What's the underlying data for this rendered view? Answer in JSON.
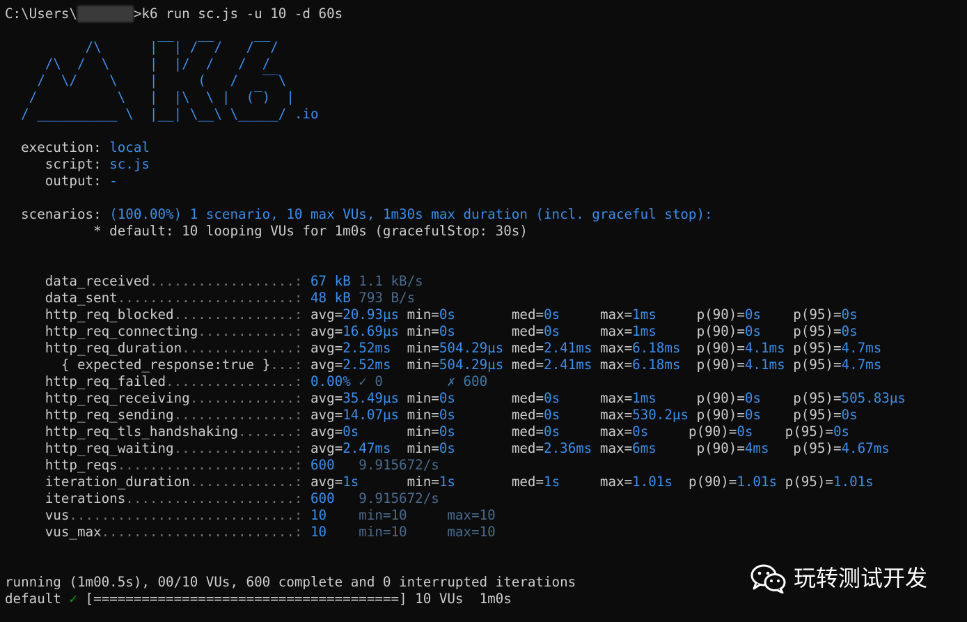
{
  "prompt": {
    "prefix": "C:\\Users\\",
    "mask": "xxxxx_x",
    "suffix": ">k6 run sc.js -u 10 -d 60s"
  },
  "logo": [
    "          /\\      |‾‾| /‾‾/   /‾‾/",
    "     /\\  /  \\     |  |/  /   /  /",
    "    /  \\/    \\    |     (   /   ‾‾\\",
    "   /          \\   |  |\\  \\ |  (‾)  |",
    "  / __________ \\  |__| \\__\\ \\_____/ .io"
  ],
  "execution": {
    "label": "  execution: ",
    "value": "local"
  },
  "script": {
    "label": "     script: ",
    "value": "sc.js"
  },
  "output": {
    "label": "     output: ",
    "value": "-"
  },
  "scenarios": {
    "label": "  scenarios: ",
    "value": "(100.00%) 1 scenario, 10 max VUs, 1m30s max duration (incl. graceful stop):",
    "detail": "           * default: 10 looping VUs for 1m0s (gracefulStop: 30s)"
  },
  "metrics": {
    "data_received": {
      "name": "     data_received",
      "dots": "..................: ",
      "v1": "67 kB",
      "v2": " 1.1 kB/s"
    },
    "data_sent": {
      "name": "     data_sent",
      "dots": "......................: ",
      "v1": "48 kB",
      "v2": " 793 B/s"
    },
    "http_req_blocked": {
      "name": "     http_req_blocked",
      "dots": "...............: ",
      "c": [
        [
          "avg=",
          "20.93µs",
          " "
        ],
        [
          "min=",
          "0s",
          "       "
        ],
        [
          "med=",
          "0s",
          "     "
        ],
        [
          "max=",
          "1ms",
          "     "
        ],
        [
          "p(90)=",
          "0s",
          "    "
        ],
        [
          "p(95)=",
          "0s",
          ""
        ]
      ]
    },
    "http_req_connecting": {
      "name": "     http_req_connecting",
      "dots": "............: ",
      "c": [
        [
          "avg=",
          "16.69µs",
          " "
        ],
        [
          "min=",
          "0s",
          "       "
        ],
        [
          "med=",
          "0s",
          "     "
        ],
        [
          "max=",
          "1ms",
          "     "
        ],
        [
          "p(90)=",
          "0s",
          "    "
        ],
        [
          "p(95)=",
          "0s",
          ""
        ]
      ]
    },
    "http_req_duration": {
      "name": "     http_req_duration",
      "dots": "..............: ",
      "c": [
        [
          "avg=",
          "2.52ms",
          "  "
        ],
        [
          "min=",
          "504.29µs",
          " "
        ],
        [
          "med=",
          "2.41ms",
          " "
        ],
        [
          "max=",
          "6.18ms",
          "  "
        ],
        [
          "p(90)=",
          "4.1ms",
          " "
        ],
        [
          "p(95)=",
          "4.7ms",
          ""
        ]
      ]
    },
    "expected_response": {
      "name": "       { expected_response:true }",
      "dots": "...: ",
      "c": [
        [
          "avg=",
          "2.52ms",
          "  "
        ],
        [
          "min=",
          "504.29µs",
          " "
        ],
        [
          "med=",
          "2.41ms",
          " "
        ],
        [
          "max=",
          "6.18ms",
          "  "
        ],
        [
          "p(90)=",
          "4.1ms",
          " "
        ],
        [
          "p(95)=",
          "4.7ms",
          ""
        ]
      ]
    },
    "http_req_failed": {
      "name": "     http_req_failed",
      "dots": "................: ",
      "v1": "0.00%",
      "check": " ✓ 0",
      "cross": "        ✗ 600"
    },
    "http_req_receiving": {
      "name": "     http_req_receiving",
      "dots": ".............: ",
      "c": [
        [
          "avg=",
          "35.49µs",
          " "
        ],
        [
          "min=",
          "0s",
          "       "
        ],
        [
          "med=",
          "0s",
          "     "
        ],
        [
          "max=",
          "1ms",
          "     "
        ],
        [
          "p(90)=",
          "0s",
          "    "
        ],
        [
          "p(95)=",
          "505.83µs",
          ""
        ]
      ]
    },
    "http_req_sending": {
      "name": "     http_req_sending",
      "dots": "...............: ",
      "c": [
        [
          "avg=",
          "14.07µs",
          " "
        ],
        [
          "min=",
          "0s",
          "       "
        ],
        [
          "med=",
          "0s",
          "     "
        ],
        [
          "max=",
          "530.2µs",
          " "
        ],
        [
          "p(90)=",
          "0s",
          "    "
        ],
        [
          "p(95)=",
          "0s",
          ""
        ]
      ]
    },
    "http_req_tls_handshaking": {
      "name": "     http_req_tls_handshaking",
      "dots": ".......: ",
      "c": [
        [
          "avg=",
          "0s",
          "      "
        ],
        [
          "min=",
          "0s",
          "       "
        ],
        [
          "med=",
          "0s",
          "     "
        ],
        [
          "max=",
          "0s",
          "     "
        ],
        [
          "p(90)=",
          "0s",
          "    "
        ],
        [
          "p(95)=",
          "0s",
          ""
        ]
      ]
    },
    "http_req_waiting": {
      "name": "     http_req_waiting",
      "dots": "...............: ",
      "c": [
        [
          "avg=",
          "2.47ms",
          "  "
        ],
        [
          "min=",
          "0s",
          "       "
        ],
        [
          "med=",
          "2.36ms",
          " "
        ],
        [
          "max=",
          "6ms",
          "     "
        ],
        [
          "p(90)=",
          "4ms",
          "   "
        ],
        [
          "p(95)=",
          "4.67ms",
          ""
        ]
      ]
    },
    "http_reqs": {
      "name": "     http_reqs",
      "dots": "......................: ",
      "v1": "600",
      "v2": "   9.915672/s"
    },
    "iteration_duration": {
      "name": "     iteration_duration",
      "dots": ".............: ",
      "c": [
        [
          "avg=",
          "1s",
          "      "
        ],
        [
          "min=",
          "1s",
          "       "
        ],
        [
          "med=",
          "1s",
          "     "
        ],
        [
          "max=",
          "1.01s",
          "  "
        ],
        [
          "p(90)=",
          "1.01s",
          " "
        ],
        [
          "p(95)=",
          "1.01s",
          ""
        ]
      ]
    },
    "iterations": {
      "name": "     iterations",
      "dots": ".....................: ",
      "v1": "600",
      "v2": "   9.915672/s"
    },
    "vus": {
      "name": "     vus",
      "dots": "............................: ",
      "v1": "10",
      "v2": "    min=10     max=10"
    },
    "vus_max": {
      "name": "     vus_max",
      "dots": "........................: ",
      "v1": "10",
      "v2": "    min=10     max=10"
    }
  },
  "status": {
    "running": "running (1m00.5s), 00/10 VUs, 600 complete and 0 interrupted iterations",
    "default_label": "default ",
    "check": "✓",
    "progress": " [======================================] 10 VUs  1m0s"
  },
  "watermark": {
    "icon": "wechat-icon",
    "text": "玩转测试开发"
  },
  "colors": {
    "background": "#0c0c0c",
    "text": "#cccccc",
    "accent": "#3b8eea",
    "dim": "#4a6a8c",
    "check": "#13a10e"
  }
}
